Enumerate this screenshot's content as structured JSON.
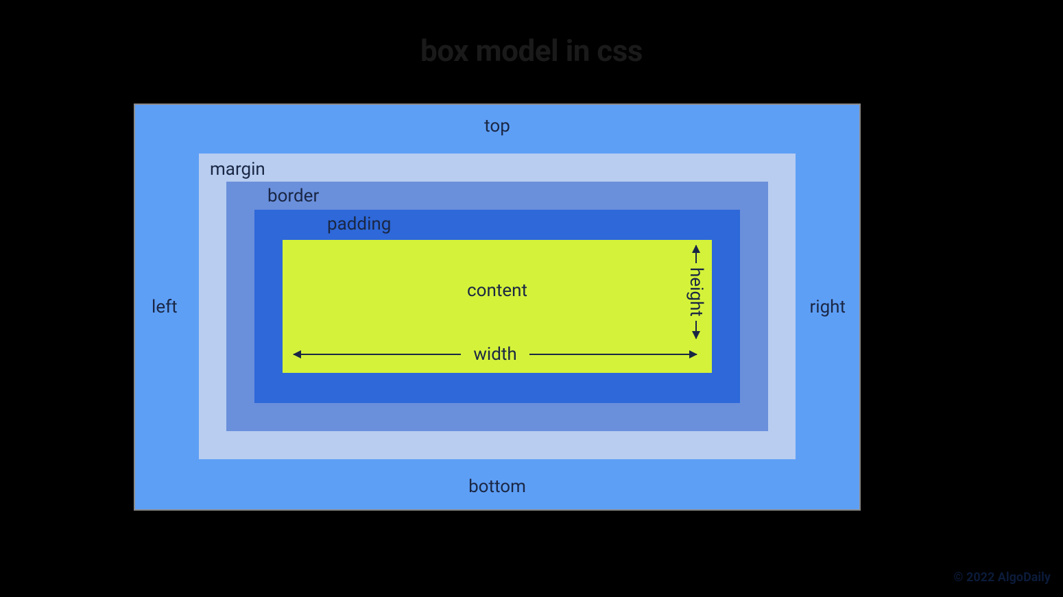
{
  "title": "box model in css",
  "sides": {
    "top": "top",
    "right": "right",
    "bottom": "bottom",
    "left": "left"
  },
  "layers": {
    "margin": "margin",
    "border": "border",
    "padding": "padding",
    "content": "content"
  },
  "dimensions": {
    "width": "width",
    "height": "height"
  },
  "credit": "© 2022 AlgoDaily",
  "colors": {
    "outer": "#5e9ff6",
    "margin": "#b8cdf0",
    "border": "#6a8fdb",
    "padding": "#2e68d9",
    "content": "#d4f23a",
    "frame_border": "#8a8a8a",
    "text": "#1a2744",
    "background": "#000000"
  }
}
